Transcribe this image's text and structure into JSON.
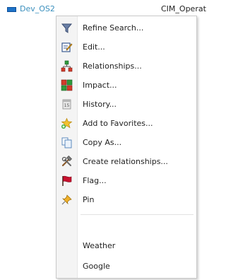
{
  "background_row": {
    "name": "Dev_OS2",
    "type_text": "CIM_Operat"
  },
  "context_menu": {
    "items": [
      {
        "label": "Refine Search...",
        "icon": "funnel-icon"
      },
      {
        "label": "Edit...",
        "icon": "edit-icon"
      },
      {
        "label": "Relationships...",
        "icon": "relationships-icon"
      },
      {
        "label": "Impact...",
        "icon": "impact-icon"
      },
      {
        "label": "History...",
        "icon": "history-icon"
      },
      {
        "label": "Add to Favorites...",
        "icon": "add-favorite-icon"
      },
      {
        "label": "Copy As...",
        "icon": "copy-icon"
      },
      {
        "label": "Create relationships...",
        "icon": "tools-icon"
      },
      {
        "label": "Flag...",
        "icon": "flag-icon"
      },
      {
        "label": "Pin",
        "icon": "pin-icon"
      }
    ],
    "extra_items": [
      {
        "label": "Weather"
      },
      {
        "label": "Google"
      }
    ]
  },
  "colors": {
    "row_name": "#3a8fbd",
    "menu_border": "#c9c9c9",
    "gutter": "#f4f4f4"
  }
}
